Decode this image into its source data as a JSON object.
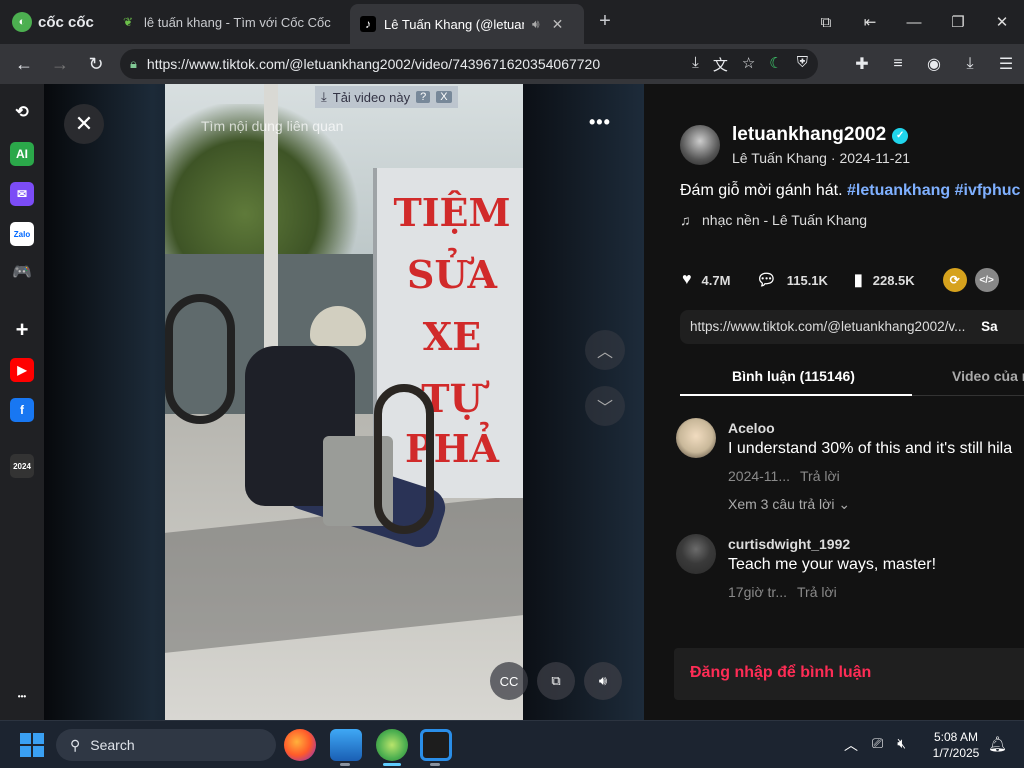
{
  "browser": {
    "brand": "cốc cốc",
    "tabs": [
      {
        "title": "lê tuấn khang - Tìm với Cốc Cốc",
        "active": false
      },
      {
        "title": "Lê Tuấn Khang (@letuank",
        "active": true
      }
    ],
    "url": "https://www.tiktok.com/@letuankhang2002/video/7439671620354067720",
    "window_controls": {
      "minimize": "—",
      "maximize": "❐",
      "close": "✕"
    }
  },
  "sidebar": {
    "items": [
      {
        "name": "history-icon",
        "glyph": "⟲",
        "color": "#ffffff",
        "bg": "transparent"
      },
      {
        "name": "ai-icon",
        "glyph": "AI",
        "color": "#ffffff",
        "bg": "#2ba84a"
      },
      {
        "name": "messenger-icon",
        "glyph": "✉",
        "color": "#ffffff",
        "bg": "#7b4cf6"
      },
      {
        "name": "zalo-icon",
        "glyph": "Zalo",
        "color": "#0068ff",
        "bg": "#ffffff"
      },
      {
        "name": "game-icon",
        "glyph": "🎮",
        "color": "#3ecf6e",
        "bg": "transparent"
      },
      {
        "name": "add-icon",
        "glyph": "+",
        "color": "#ffffff",
        "bg": "transparent"
      },
      {
        "name": "youtube-icon",
        "glyph": "▶",
        "color": "#ffffff",
        "bg": "#ff0000"
      },
      {
        "name": "facebook-icon",
        "glyph": "f",
        "color": "#ffffff",
        "bg": "#1877f2"
      },
      {
        "name": "coccoc-2024-icon",
        "glyph": "2024",
        "color": "#ffffff",
        "bg": "#333333"
      },
      {
        "name": "more-icon",
        "glyph": "•••",
        "color": "#ffffff",
        "bg": "transparent"
      }
    ]
  },
  "video": {
    "related_hint": "Tìm nội dung liên quan",
    "promo_label": "Tải video này",
    "promo_help": "?",
    "promo_close": "X",
    "sign_lines": [
      "TIỆM",
      "SỬA",
      "XE",
      "TỰ",
      "PHẢ"
    ]
  },
  "post": {
    "username": "letuankhang2002",
    "display_name": "Lê Tuấn Khang",
    "date": "2024-11-21",
    "caption_text": "Đám giỗ mời gánh hát. ",
    "hashtags": [
      "#letuankhang",
      "#ivfphuc"
    ],
    "music": "nhạc nền - Lê Tuấn Khang",
    "likes": "4.7M",
    "comments": "115.1K",
    "saves": "228.5K",
    "link": "https://www.tiktok.com/@letuankhang2002/v...",
    "link_action": "Sa"
  },
  "panel_tabs": {
    "comments": "Bình luận (115146)",
    "creator_videos": "Video của n"
  },
  "comments": [
    {
      "user": "Aceloo",
      "text": "I understand 30% of this and it's still hila",
      "time": "2024-11...",
      "reply": "Trả lời",
      "more_replies": "Xem 3 câu trả lời",
      "avatar_color": "#c9b89a"
    },
    {
      "user": "curtisdwight_1992",
      "text": "Teach me your ways, master!",
      "time": "17giờ tr...",
      "reply": "Trả lời",
      "more_replies": "",
      "avatar_color": "#3a3a3a"
    }
  ],
  "login_prompt": "Đăng nhập để bình luận",
  "taskbar": {
    "search_label": "Search",
    "time": "5:08 AM",
    "date": "1/7/2025"
  },
  "colors": {
    "accent_red": "#fe2c55",
    "hashtag_blue": "#7fb0ff",
    "verified": "#20d5ec"
  }
}
